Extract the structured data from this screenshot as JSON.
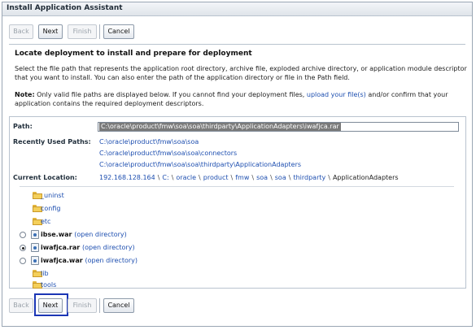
{
  "window": {
    "title": "Install Application Assistant"
  },
  "buttons": {
    "back": "Back",
    "next": "Next",
    "finish": "Finish",
    "cancel": "Cancel"
  },
  "heading": "Locate deployment to install and prepare for deployment",
  "description": "Select the file path that represents the application root directory, archive file, exploded archive directory, or application module descriptor that you want to install. You can also enter the path of the application directory or file in the Path field.",
  "note": {
    "label": "Note:",
    "text_before": " Only valid file paths are displayed below. If you cannot find your deployment files, ",
    "link": "upload your file(s)",
    "text_after": " and/or confirm that your application contains the required deployment descriptors."
  },
  "path": {
    "label": "Path:",
    "value": "C:\\oracle\\product\\fmw\\soa\\soa\\thirdparty\\ApplicationAdapters\\iwafjca.rar"
  },
  "recent": {
    "label": "Recently Used Paths:",
    "items": [
      "C:\\oracle\\product\\fmw\\soa\\soa",
      "C:\\oracle\\product\\fmw\\soa\\soa\\connectors",
      "C:\\oracle\\product\\fmw\\soa\\soa\\thirdparty\\ApplicationAdapters"
    ]
  },
  "location": {
    "label": "Current Location:",
    "crumbs": [
      "192.168.128.164",
      "C:",
      "oracle",
      "product",
      "fmw",
      "soa",
      "soa",
      "thirdparty"
    ],
    "separator": "\\",
    "current": "ApplicationAdapters"
  },
  "files": [
    {
      "name": "_uninst",
      "kind": "folder"
    },
    {
      "name": "config",
      "kind": "folder"
    },
    {
      "name": "etc",
      "kind": "folder"
    },
    {
      "name": "ibse.war",
      "kind": "file",
      "selected": false,
      "open": "(open directory)"
    },
    {
      "name": "iwafjca.rar",
      "kind": "file",
      "selected": true,
      "open": "(open directory)"
    },
    {
      "name": "iwafjca.war",
      "kind": "file",
      "selected": false,
      "open": "(open directory)"
    },
    {
      "name": "lib",
      "kind": "folder"
    },
    {
      "name": "tools",
      "kind": "folder"
    }
  ]
}
